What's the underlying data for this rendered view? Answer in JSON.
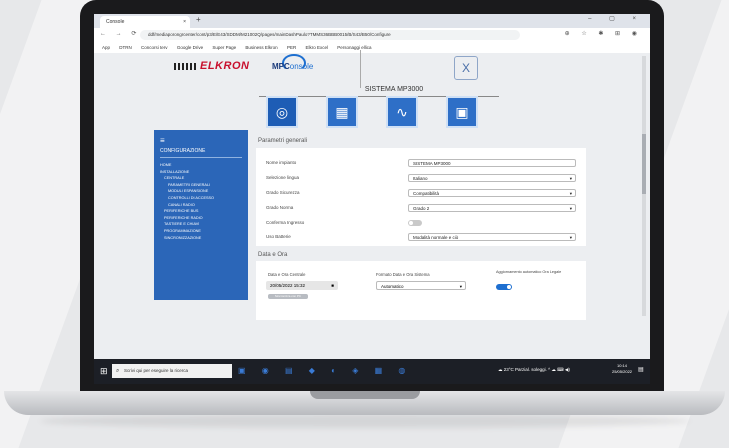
{
  "browser": {
    "tab_title": "Console",
    "tab_close": "×",
    "new_tab": "+",
    "window_controls": "–  ▢  ×",
    "nav": "←  →  ⟳",
    "url": "ddf/mediaporongrcenter/cont/p3/E/E43/SDDM/M21002Q/pages/mainDashPaulo?TMMS36BBB0015/B/S43/B50/Configure",
    "addr_icons": "⊕ ☆ ✱ ⊞ ◉",
    "bookmarks": [
      "App",
      "DTRN",
      "Concorsi terv",
      "Google Drive",
      "Super Page",
      "Business Elkron",
      "PER",
      "Elkro Excel",
      "Personaggi ellica"
    ]
  },
  "header": {
    "brand_left": "ELKRON",
    "brand_mpc": "MPC",
    "brand_mpc_sub": "onsole",
    "close_label": "X",
    "system_title": "SISTEMA MP3000"
  },
  "sidebar": {
    "menu_icon": "≡",
    "heading": "CONFIGURAZIONE",
    "items": [
      "HOME",
      "INSTALLAZIONE",
      "CENTRALE",
      "PARAMETRI GENERALI",
      "MODULI ESPANSIONE",
      "CONTROLLI DI ACCESSO",
      "CANALI RADIO",
      "PERIFERICHE BUS",
      "PERIFERICHE RADIO",
      "TASTIERE E CHIAVI",
      "PROGRAMMAZIONE",
      "SINCRONIZZAZIONE"
    ]
  },
  "tiles": [
    "◎",
    "▦",
    "∿",
    "▣"
  ],
  "general": {
    "section_title": "Parametri generali",
    "rows": [
      {
        "label": "Nome impianto",
        "value": "SISTEMA MP3000",
        "type": "text"
      },
      {
        "label": "Selezione lingua",
        "value": "Italiano",
        "type": "select"
      },
      {
        "label": "Grado Sicurezza",
        "value": "Compatibilità",
        "type": "select"
      },
      {
        "label": "Grado Norma",
        "value": "Grado 2",
        "type": "select"
      },
      {
        "label": "Conferma Ingresso",
        "value": "",
        "type": "toggle"
      },
      {
        "label": "Uso Batterie",
        "value": "Modalità normale e ciò",
        "type": "select"
      }
    ]
  },
  "datetime": {
    "section_title": "Data e Ora",
    "current_label": "Data e Ora Centrale",
    "current_value": "20/05/2022 15:32",
    "sync_button": "Sincronizza con PC",
    "format_label": "Formato Data e Ora Sistema",
    "format_value": "Automatico",
    "auto_update_label": "Aggiornamento automatico Ora Legale"
  },
  "taskbar": {
    "start_icon": "⊞",
    "search_placeholder": "Scrivi qui per eseguire la ricerca",
    "apps": "▣ ◉ ▤ ◆ ◐ ◈ ▦ ◍",
    "tray": "☁ 23°C Parzial. soleggi.  ^ ☁ ⌨ ◀)",
    "time": "10:14",
    "date": "25/05/2022",
    "notifications": "▤"
  }
}
